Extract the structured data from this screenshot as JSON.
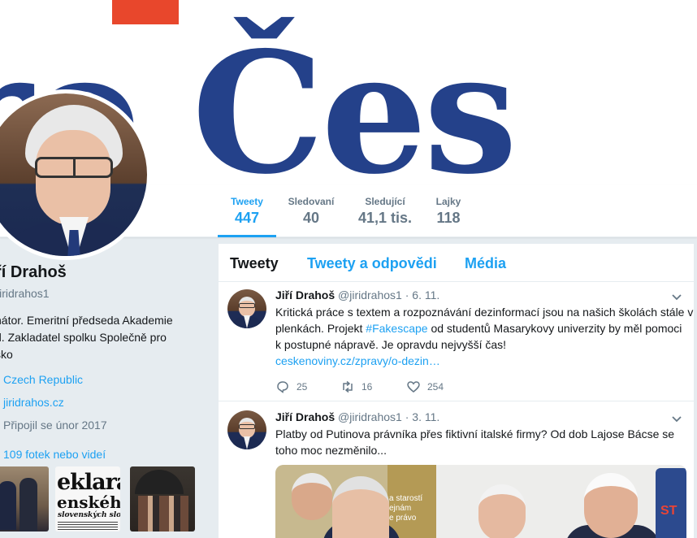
{
  "banner": {
    "text": "ro Čes"
  },
  "stats": [
    {
      "label": "Tweety",
      "value": "447"
    },
    {
      "label": "Sledovaní",
      "value": "40"
    },
    {
      "label": "Sledující",
      "value": "41,1 tis."
    },
    {
      "label": "Lajky",
      "value": "118"
    }
  ],
  "profile": {
    "name": "ří Drahoš",
    "handle": "jiridrahos1",
    "bio": [
      "nátor. Emeritní předseda Akademie",
      "d. Zakladatel spolku Společně pro",
      "sko"
    ],
    "location": "Czech Republic",
    "website": "jiridrahos.cz",
    "joined": "Připojil se únor 2017",
    "photos_label": "109 fotek nebo videí",
    "photo2_text": [
      "eklarác",
      "enského Ná",
      "slovenských slovenských polit"
    ]
  },
  "tabs": [
    "Tweety",
    "Tweety a odpovědi",
    "Média"
  ],
  "tweets": [
    {
      "name": "Jiří Drahoš",
      "handle": "@jiridrahos1",
      "date": "· 6. 11.",
      "text_lines": [
        [
          "Kritická práce s textem a rozpoznávání dezinformací jsou na našich školách stále v"
        ],
        [
          "plenkách. Projekt ",
          "#Fakescape",
          " od studentů Masarykovy univerzity by měl pomoci"
        ],
        [
          "k postupné nápravě. Je opravdu nejvyšší čas!"
        ]
      ],
      "link": "ceskenoviny.cz/zpravy/o-dezin…",
      "replies": "25",
      "retweets": "16",
      "likes": "254"
    },
    {
      "name": "Jiří Drahoš",
      "handle": "@jiridrahos1",
      "date": "· 3. 11.",
      "text_lines": [
        [
          "Platby od Putinova právníka přes fiktivní italské firmy? Od dob Lajose Bácse se"
        ],
        [
          "toho moc nezměnilo..."
        ]
      ],
      "media_text": [
        "a starostí",
        "ejnám",
        "e právo"
      ]
    }
  ],
  "colors": {
    "accent": "#1da1f2",
    "banner_blue": "#24418a",
    "banner_red": "#e8472c"
  }
}
